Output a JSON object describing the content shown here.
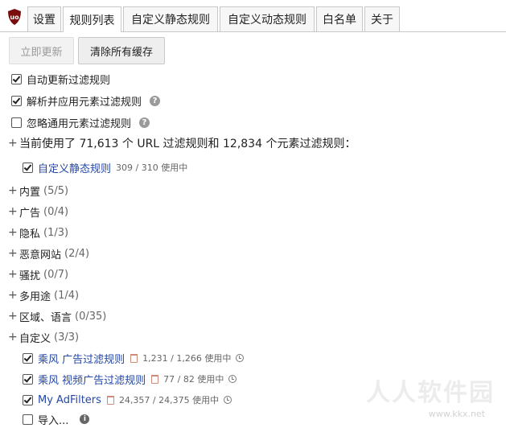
{
  "tabs": [
    {
      "label": "设置"
    },
    {
      "label": "规则列表"
    },
    {
      "label": "自定义静态规则"
    },
    {
      "label": "自定义动态规则"
    },
    {
      "label": "白名单"
    },
    {
      "label": "关于"
    }
  ],
  "buttons": {
    "update_now": "立即更新",
    "purge_cache": "清除所有缓存"
  },
  "options": {
    "auto_update": "自动更新过滤规则",
    "parse_cosmetic": "解析并应用元素过滤规则",
    "ignore_generic": "忽略通用元素过滤规则"
  },
  "summary": "当前使用了 71,613 个 URL 过滤规则和 12,834 个元素过滤规则：",
  "user_filters": {
    "label": "自定义静态规则",
    "stat": "309 / 310 使用中"
  },
  "groups": [
    {
      "name": "内置",
      "count": "(5/5)"
    },
    {
      "name": "广告",
      "count": "(0/4)"
    },
    {
      "name": "隐私",
      "count": "(1/3)"
    },
    {
      "name": "恶意网站",
      "count": "(2/4)"
    },
    {
      "name": "骚扰",
      "count": "(0/7)"
    },
    {
      "name": "多用途",
      "count": "(1/4)"
    },
    {
      "name": "区域、语言",
      "count": "(0/35)"
    },
    {
      "name": "自定义",
      "count": "(3/3)"
    }
  ],
  "custom_lists": [
    {
      "name": "乘风 广告过滤规则",
      "stat": "1,231 / 1,266 使用中"
    },
    {
      "name": "乘风 视频广告过滤规则",
      "stat": "77 / 82 使用中"
    },
    {
      "name": "My AdFilters",
      "stat": "24,357 / 24,375 使用中"
    }
  ],
  "import_label": "导入...",
  "colors": {
    "link": "#2447a8",
    "logo": "#7a0d0d"
  },
  "watermark": {
    "text": "人人软件园",
    "url": "www.kkx.net"
  }
}
